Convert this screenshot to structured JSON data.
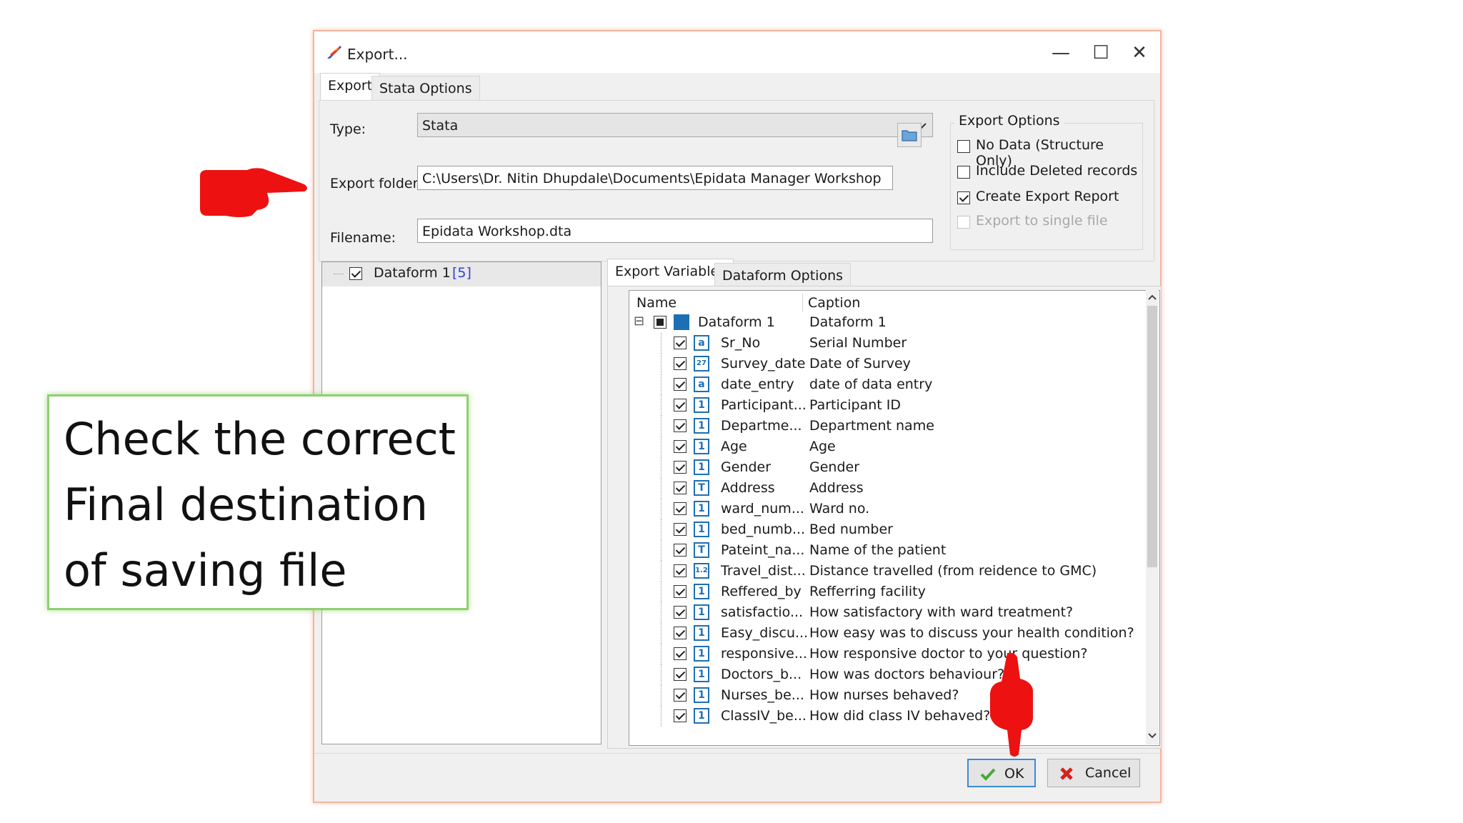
{
  "window": {
    "title": "Export...",
    "icon": "feather-quill-icon",
    "controls": {
      "minimize": "—",
      "maximize": "☐",
      "close": "✕"
    }
  },
  "tabs": [
    {
      "label": "Export",
      "selected": true
    },
    {
      "label": "Stata Options",
      "selected": false
    }
  ],
  "form": {
    "type_label": "Type:",
    "type_value": "Stata",
    "folder_label": "Export folder:",
    "folder_value": "C:\\Users\\Dr. Nitin Dhupdale\\Documents\\Epidata Manager Workshop",
    "filename_label": "Filename:",
    "filename_value": "Epidata Workshop.dta"
  },
  "export_options": {
    "title": "Export Options",
    "items": [
      {
        "label": "No Data (Structure Only)",
        "checked": false,
        "enabled": true
      },
      {
        "label": "Include Deleted records",
        "checked": false,
        "enabled": true
      },
      {
        "label": "Create Export Report",
        "checked": true,
        "enabled": true
      },
      {
        "label": "Export to single file",
        "checked": false,
        "enabled": false
      }
    ]
  },
  "dataform_tree": {
    "label": "Dataform 1",
    "count": "[5]",
    "checked": true
  },
  "inner_tabs": [
    {
      "label": "Export Variables",
      "selected": true
    },
    {
      "label": "Dataform Options",
      "selected": false
    }
  ],
  "variables": {
    "columns": [
      "Name",
      "Caption"
    ],
    "root": {
      "name": "Dataform 1",
      "caption": "Dataform 1",
      "expander": "⊟"
    },
    "rows": [
      {
        "name": "Sr_No",
        "caption": "Serial Number",
        "icon": "auto-number-icon",
        "glyph": "a"
      },
      {
        "name": "Survey_date",
        "caption": "Date of Survey",
        "icon": "calendar-icon",
        "glyph": "27"
      },
      {
        "name": "date_entry",
        "caption": "date of data entry",
        "icon": "auto-date-icon",
        "glyph": "a"
      },
      {
        "name": "Participant...",
        "caption": "Participant ID",
        "icon": "integer-icon",
        "glyph": "1"
      },
      {
        "name": "Departme...",
        "caption": "Department name",
        "icon": "integer-icon",
        "glyph": "1"
      },
      {
        "name": "Age",
        "caption": "Age",
        "icon": "integer-icon",
        "glyph": "1"
      },
      {
        "name": "Gender",
        "caption": "Gender",
        "icon": "integer-icon",
        "glyph": "1"
      },
      {
        "name": "Address",
        "caption": "Address",
        "icon": "text-icon",
        "glyph": "T"
      },
      {
        "name": "ward_num...",
        "caption": "Ward no.",
        "icon": "integer-icon",
        "glyph": "1"
      },
      {
        "name": "bed_numb...",
        "caption": "Bed number",
        "icon": "integer-icon",
        "glyph": "1"
      },
      {
        "name": "Pateint_na...",
        "caption": "Name of the patient",
        "icon": "text-icon",
        "glyph": "T"
      },
      {
        "name": "Travel_dist...",
        "caption": "Distance travelled (from reidence to GMC)",
        "icon": "float-icon",
        "glyph": "1.2"
      },
      {
        "name": "Reffered_by",
        "caption": "Refferring facility",
        "icon": "integer-icon",
        "glyph": "1"
      },
      {
        "name": "satisfactio...",
        "caption": "How satisfactory with ward treatment?",
        "icon": "integer-icon",
        "glyph": "1"
      },
      {
        "name": "Easy_discu...",
        "caption": "How easy was to discuss your health condition?",
        "icon": "integer-icon",
        "glyph": "1"
      },
      {
        "name": "responsive...",
        "caption": "How responsive doctor to your question?",
        "icon": "integer-icon",
        "glyph": "1"
      },
      {
        "name": "Doctors_b...",
        "caption": "How was doctors behaviour?",
        "icon": "integer-icon",
        "glyph": "1"
      },
      {
        "name": "Nurses_be...",
        "caption": "How nurses behaved?",
        "icon": "integer-icon",
        "glyph": "1"
      },
      {
        "name": "ClassIV_be...",
        "caption": "How did class IV behaved?",
        "icon": "integer-icon",
        "glyph": "1"
      }
    ]
  },
  "buttons": {
    "ok": "OK",
    "cancel": "Cancel"
  },
  "annotation": {
    "callout_lines": [
      "Check the correct",
      "Final destination",
      "of saving file"
    ],
    "arrow_color": "#ee1111",
    "callout_border": "#8fd06f"
  }
}
